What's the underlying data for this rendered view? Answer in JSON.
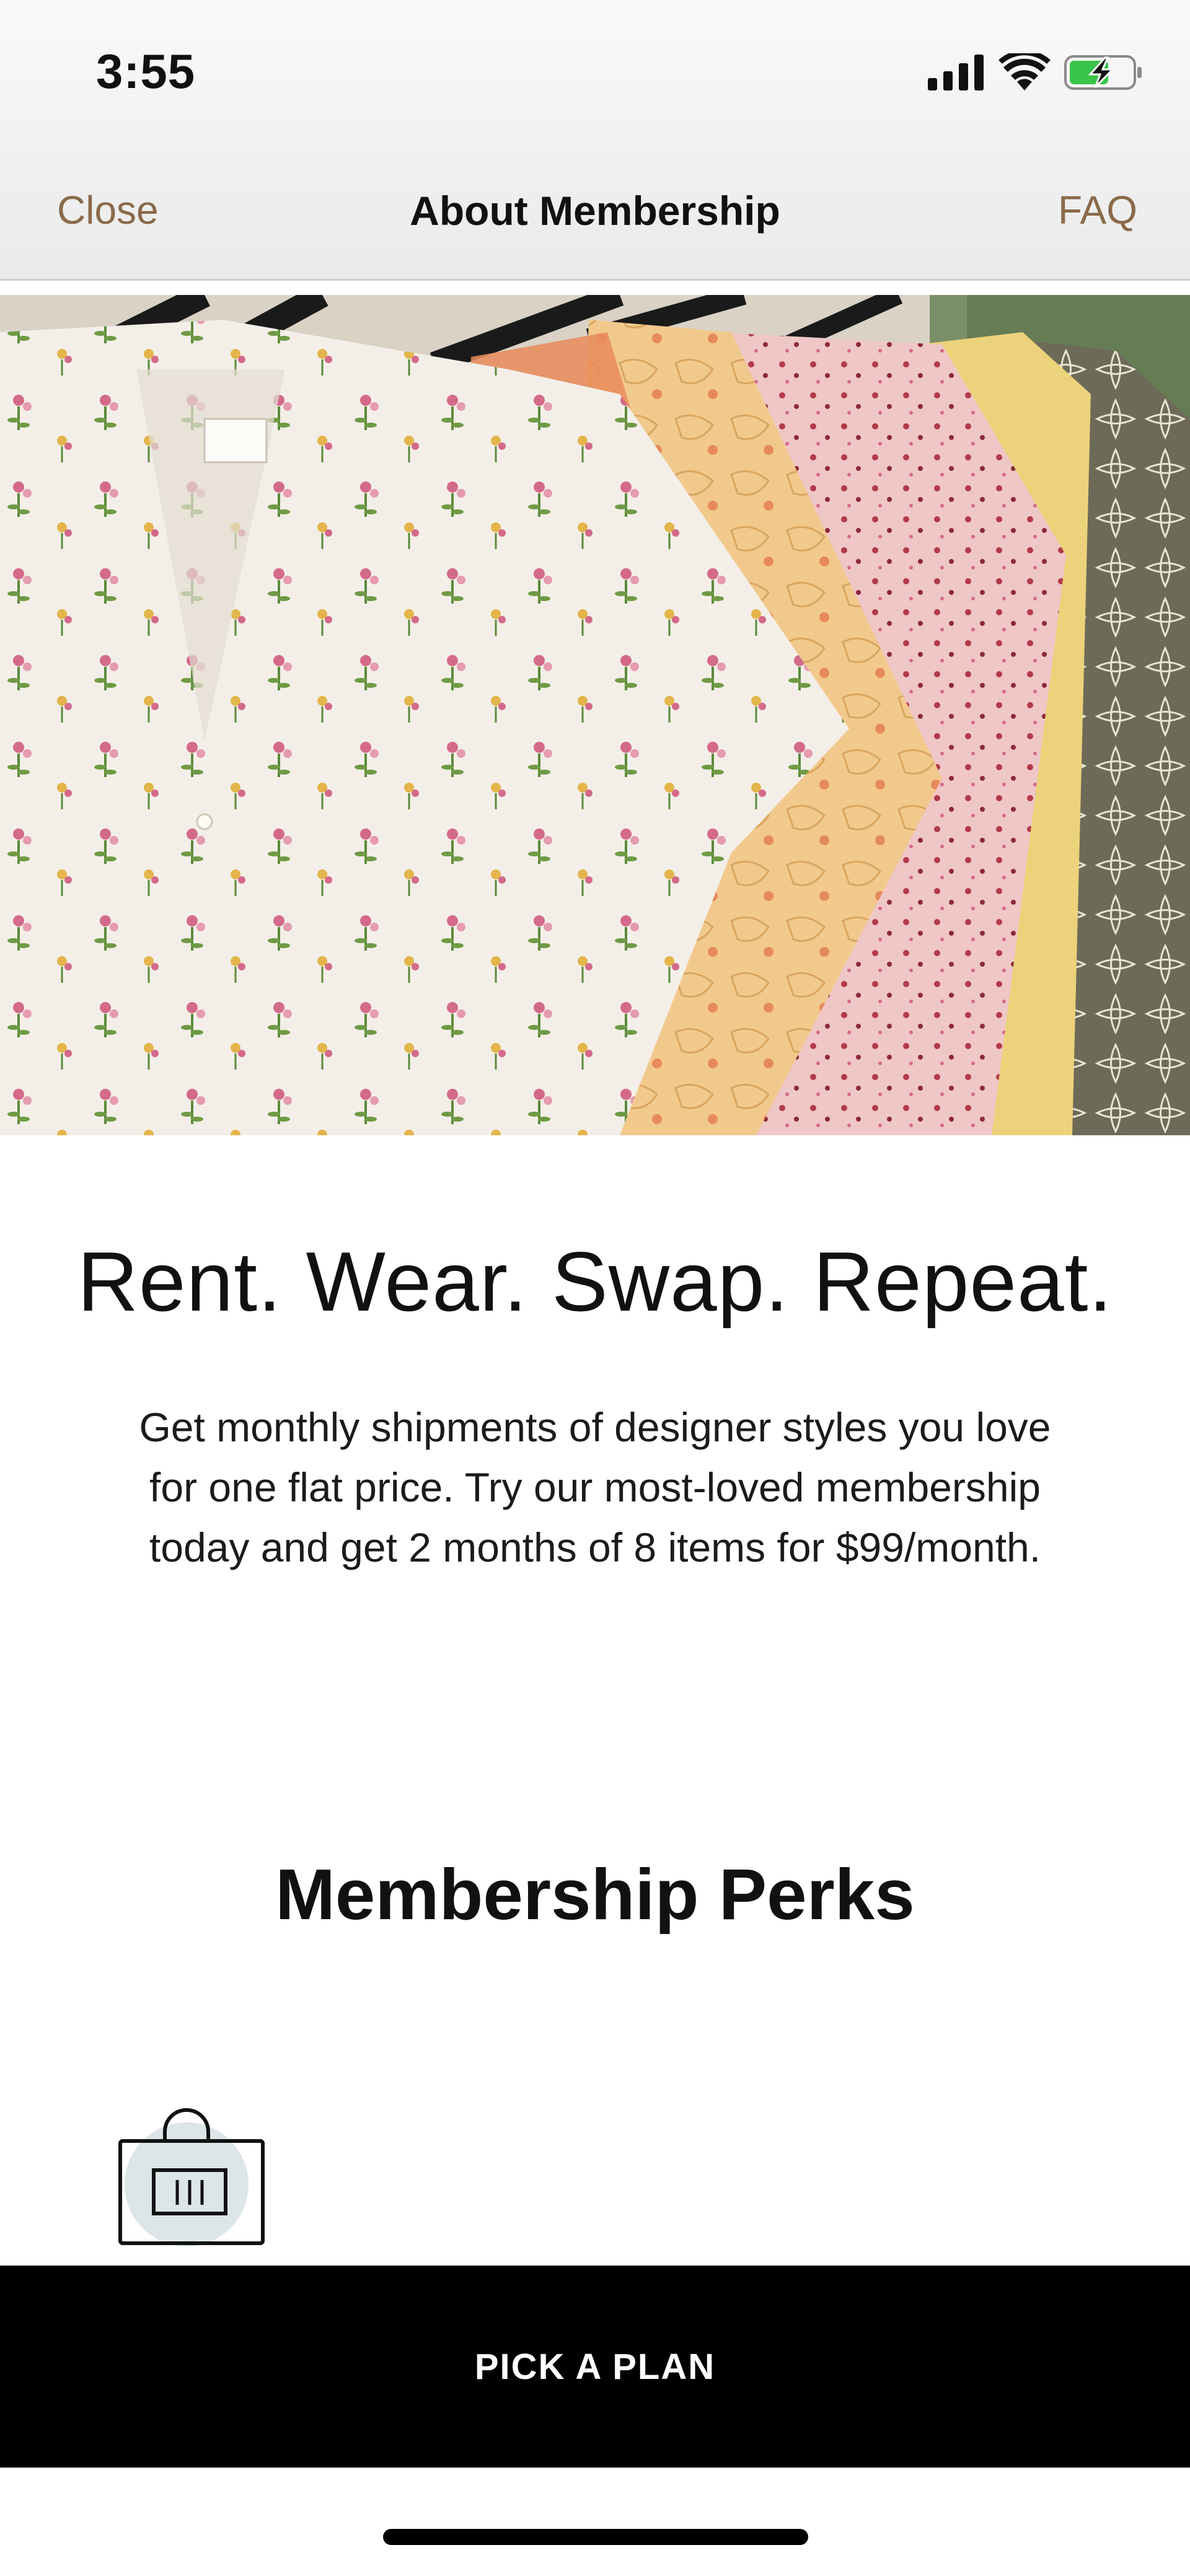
{
  "status_bar": {
    "time": "3:55",
    "icons": [
      "cellular-signal-icon",
      "wifi-icon",
      "battery-charging-icon"
    ]
  },
  "nav": {
    "close_label": "Close",
    "title": "About Membership",
    "faq_label": "FAQ",
    "accent_color": "#8a6a4a"
  },
  "hero": {
    "image": "floral-dresses-on-rack-image"
  },
  "main": {
    "headline": "Rent. Wear. Swap. Repeat.",
    "description": "Get monthly shipments of designer styles you love for one flat price. Try our most-loved membership today and get 2 months of 8 items for $99/month.",
    "perks_title": "Membership Perks",
    "perk_icon": "shopping-bag-icon"
  },
  "cta": {
    "label": "PICK A PLAN",
    "background": "#000000"
  }
}
